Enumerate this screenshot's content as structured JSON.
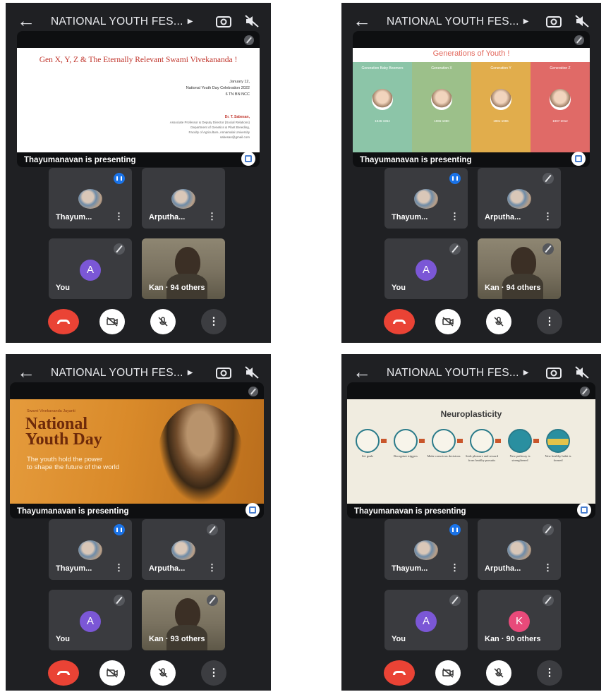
{
  "panels": [
    {
      "title": "NATIONAL YOUTH FES...",
      "presenting": "Thayumanavan is presenting",
      "tiles": [
        "Thayum...",
        "Arputha...",
        "You",
        "Kan · 94 others"
      ],
      "avatar_letter": "A",
      "slide": {
        "title": "Gen X, Y, Z & The Eternally Relevant Swami Vivekananda !",
        "date": "January 12,",
        "event": "National Youth Day Celebration 2022",
        "unit": "6 TN BN NCC",
        "author": "Dr. T. Sabesan,",
        "author_role": "Associate Professor & Deputy Director (Social Relations)",
        "dept": "Department of Genetics & Plant Breeding,",
        "faculty": "Faculty of Agriculture, Annamalai University",
        "email": "sabesan@gmail.com"
      }
    },
    {
      "title": "NATIONAL YOUTH FES...",
      "presenting": "Thayumanavan is presenting",
      "tiles": [
        "Thayum...",
        "Arputha...",
        "You",
        "Kan · 94 others"
      ],
      "avatar_letter": "A",
      "slide": {
        "title": "Generations of Youth !",
        "columns": [
          {
            "head": "Generation Baby Boomers",
            "years": "1946-1964",
            "color": "#8cc5a8"
          },
          {
            "head": "Generation X",
            "years": "1965-1980",
            "color": "#9cc08a"
          },
          {
            "head": "Generation Y",
            "years": "1981-1996",
            "color": "#e1ad4c"
          },
          {
            "head": "Generation Z",
            "years": "1997-2012",
            "color": "#e06a67"
          }
        ]
      }
    },
    {
      "title": "NATIONAL YOUTH FES...",
      "presenting": "Thayumanavan is presenting",
      "tiles": [
        "Thayum...",
        "Arputha...",
        "You",
        "Kan · 93 others"
      ],
      "avatar_letter": "A",
      "slide": {
        "small": "Swami Vivekananda Jayanti",
        "big1": "National",
        "big2": "Youth Day",
        "tag1": "The youth hold the power",
        "tag2": "to shape the future of the world"
      }
    },
    {
      "title": "NATIONAL YOUTH FES...",
      "presenting": "Thayumanavan is presenting",
      "tiles": [
        "Thayum...",
        "Arputha...",
        "You",
        "Kan · 90 others"
      ],
      "avatar_letter": "A",
      "k_letter": "K",
      "slide": {
        "title": "Neuroplasticity",
        "steps": [
          "Set goals",
          "Recognize triggers",
          "Make conscious decisions",
          "Seek pleasure and reward from healthy pursuits",
          "New pathway is strengthened",
          "New healthy habit is formed"
        ]
      }
    }
  ],
  "colors": {
    "hangup": "#ea4335",
    "speaking": "#1a73e8",
    "avatar_a": "#7b57d6",
    "avatar_k": "#e84a7a"
  }
}
